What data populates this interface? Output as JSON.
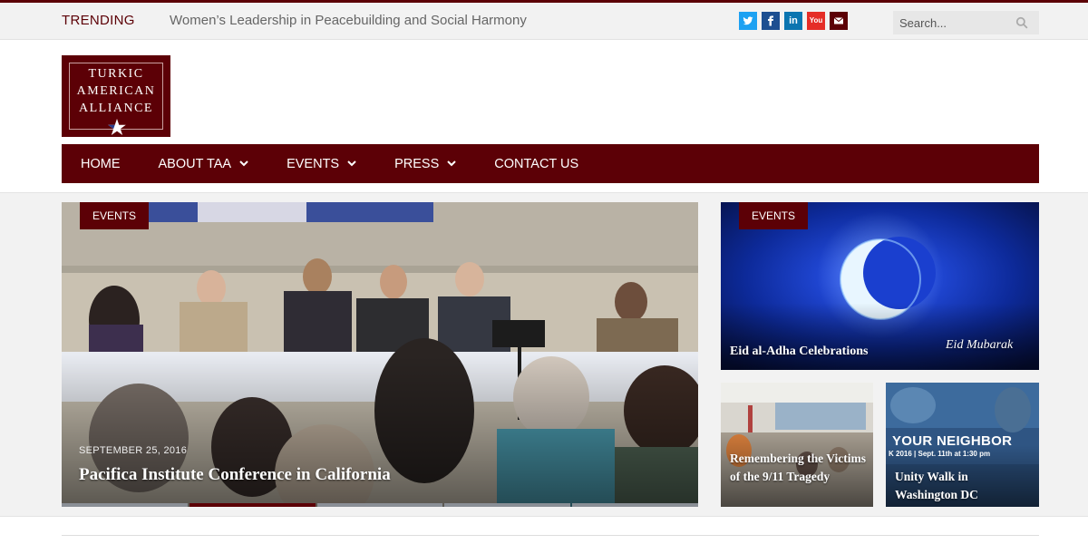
{
  "topbar": {
    "trending_label": "TRENDING",
    "trending_headline": "Women’s Leadership in Peacebuilding and Social Harmony",
    "social": [
      {
        "name": "twitter-icon",
        "color": "#1da1f2"
      },
      {
        "name": "facebook-icon",
        "color": "#1d4f91"
      },
      {
        "name": "linkedin-icon",
        "color": "#0b75b0"
      },
      {
        "name": "youtube-icon",
        "color": "#e52d27"
      },
      {
        "name": "email-icon",
        "color": "#5c0006"
      }
    ],
    "linkedin_text": "in",
    "youtube_text": "You",
    "search_placeholder": "Search..."
  },
  "logo": {
    "line1": "TURKIC",
    "line2": "AMERICAN",
    "line3": "ALLIANCE"
  },
  "nav": {
    "items": [
      {
        "label": "HOME",
        "dropdown": false
      },
      {
        "label": "ABOUT TAA",
        "dropdown": true
      },
      {
        "label": "EVENTS",
        "dropdown": true
      },
      {
        "label": "PRESS",
        "dropdown": true
      },
      {
        "label": "CONTACT US",
        "dropdown": false
      }
    ]
  },
  "featured": {
    "main": {
      "tag": "EVENTS",
      "date": "SEPTEMBER 25, 2016",
      "title": "Pacifica Institute Conference in California",
      "slider_active": 1
    },
    "eid": {
      "tag": "EVENTS",
      "title": "Eid al-Adha Celebrations",
      "overlay_text": "Eid Mubarak"
    },
    "small1": {
      "title": "Remembering the Victims of the 9/11 Tragedy"
    },
    "small2": {
      "title": "Unity Walk in Washington DC",
      "banner_text": "YOUR NEIGHBOR",
      "banner_sub": "K 2016 | Sept. 11th at 1:30 pm"
    }
  },
  "colors": {
    "brand": "#5c0006",
    "topbar_bg": "#f2f2f2"
  }
}
